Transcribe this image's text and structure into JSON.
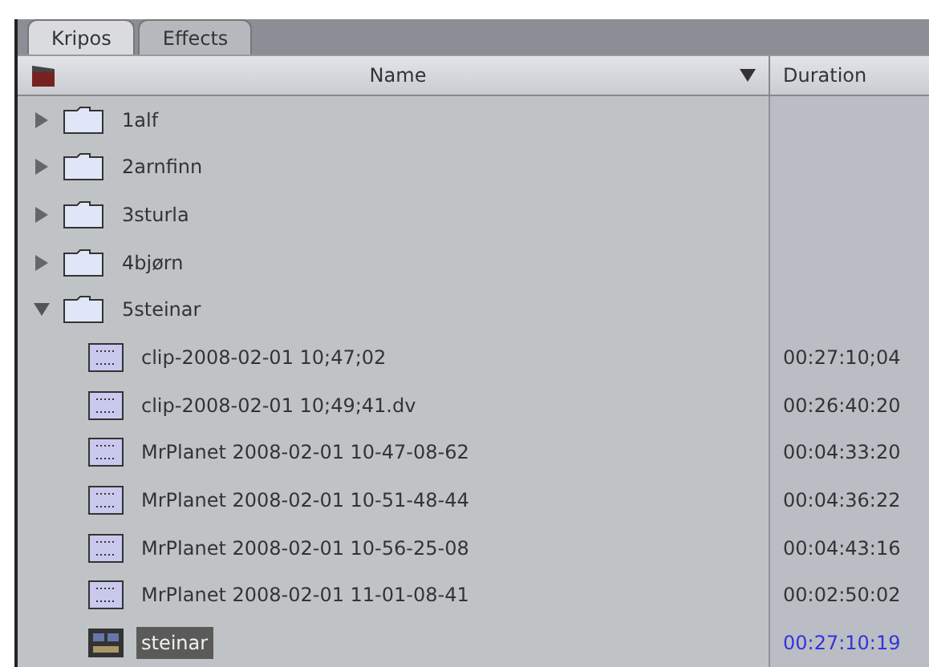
{
  "tabs": [
    {
      "label": "Kripos",
      "selected": true
    },
    {
      "label": "Effects",
      "selected": false
    }
  ],
  "columns": {
    "name": "Name",
    "duration": "Duration"
  },
  "items": [
    {
      "kind": "bin",
      "name": "1alf",
      "expanded": false
    },
    {
      "kind": "bin",
      "name": "2arnfinn",
      "expanded": false
    },
    {
      "kind": "bin",
      "name": "3sturla",
      "expanded": false
    },
    {
      "kind": "bin",
      "name": "4bjørn",
      "expanded": false
    },
    {
      "kind": "bin",
      "name": "5steinar",
      "expanded": true,
      "children": [
        {
          "kind": "clip",
          "name": "clip-2008-02-01 10;47;02",
          "duration": "00:27:10;04",
          "selected": false
        },
        {
          "kind": "clip",
          "name": "clip-2008-02-01 10;49;41.dv",
          "duration": "00:26:40:20",
          "selected": false
        },
        {
          "kind": "clip",
          "name": "MrPlanet 2008-02-01 10-47-08-62",
          "duration": "00:04:33:20",
          "selected": false
        },
        {
          "kind": "clip",
          "name": "MrPlanet 2008-02-01 10-51-48-44",
          "duration": "00:04:36:22",
          "selected": false
        },
        {
          "kind": "clip",
          "name": "MrPlanet 2008-02-01 10-56-25-08",
          "duration": "00:04:43:16",
          "selected": false
        },
        {
          "kind": "clip",
          "name": "MrPlanet 2008-02-01 11-01-08-41",
          "duration": "00:02:50:02",
          "selected": false
        },
        {
          "kind": "sequence",
          "name": "steinar",
          "duration": "00:27:10:19",
          "selected": true
        }
      ]
    }
  ]
}
